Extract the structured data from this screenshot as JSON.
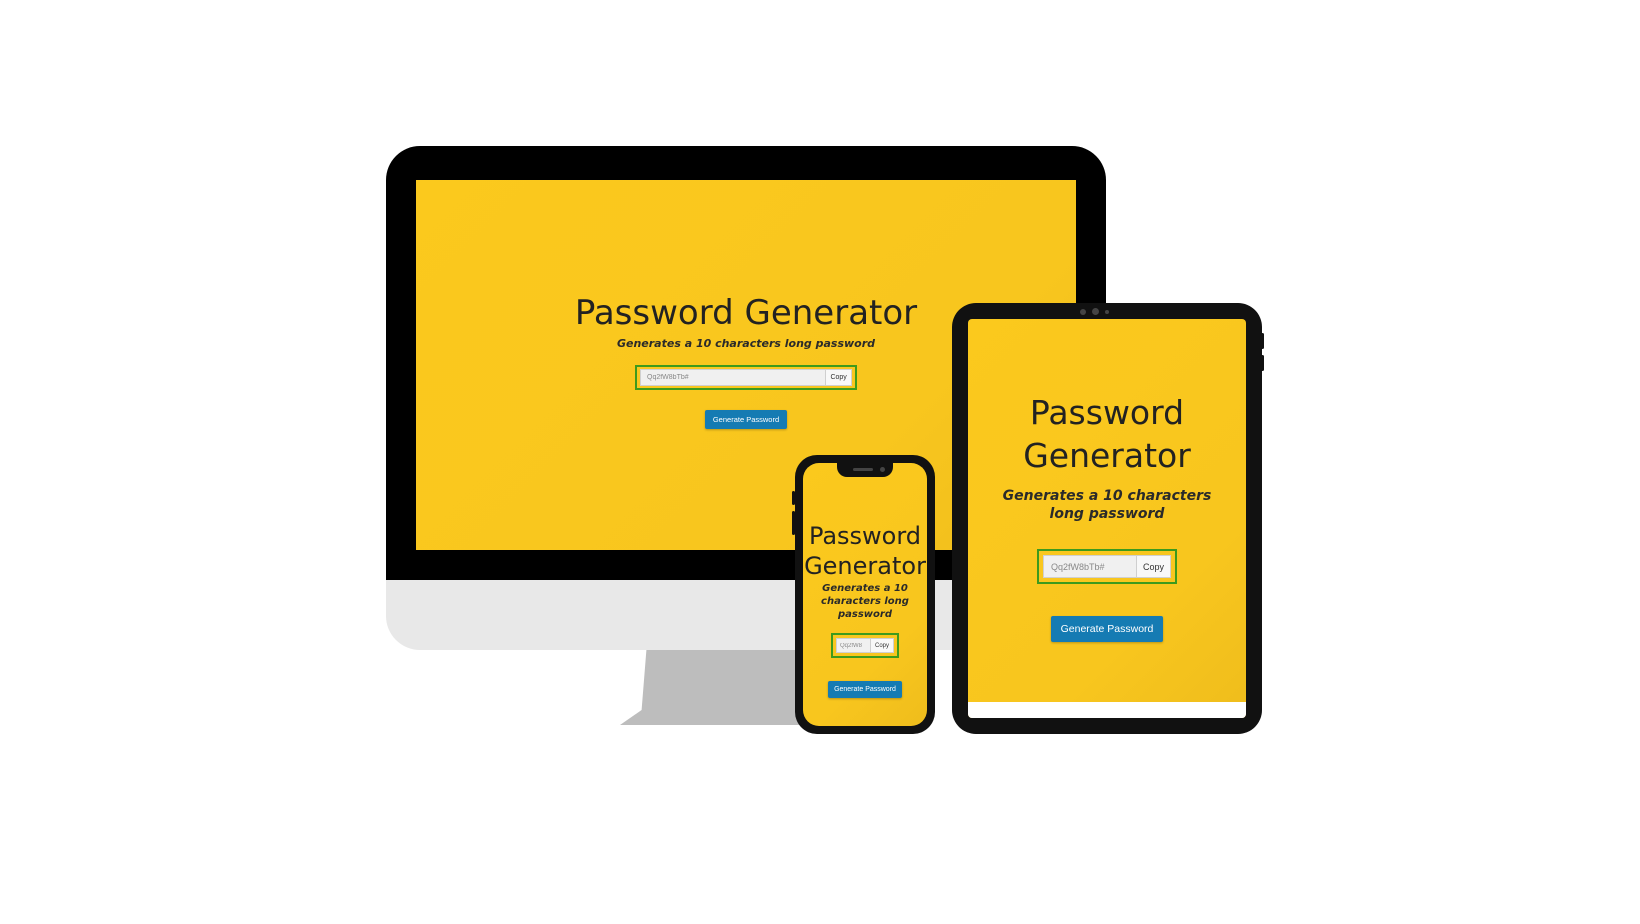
{
  "app": {
    "title": "Password Generator",
    "subtitle": "Generates a 10 characters long password",
    "password_value_full": "Qq2fW8bTb#",
    "password_value_phone": "Qq2fW8",
    "copy_label": "Copy",
    "generate_label": "Generate Password"
  },
  "colors": {
    "background": "#fbc91d",
    "accent_button": "#157bb3",
    "field_border": "#3d9a1d",
    "text": "#222222"
  },
  "devices": [
    "desktop-monitor",
    "tablet",
    "phone"
  ]
}
